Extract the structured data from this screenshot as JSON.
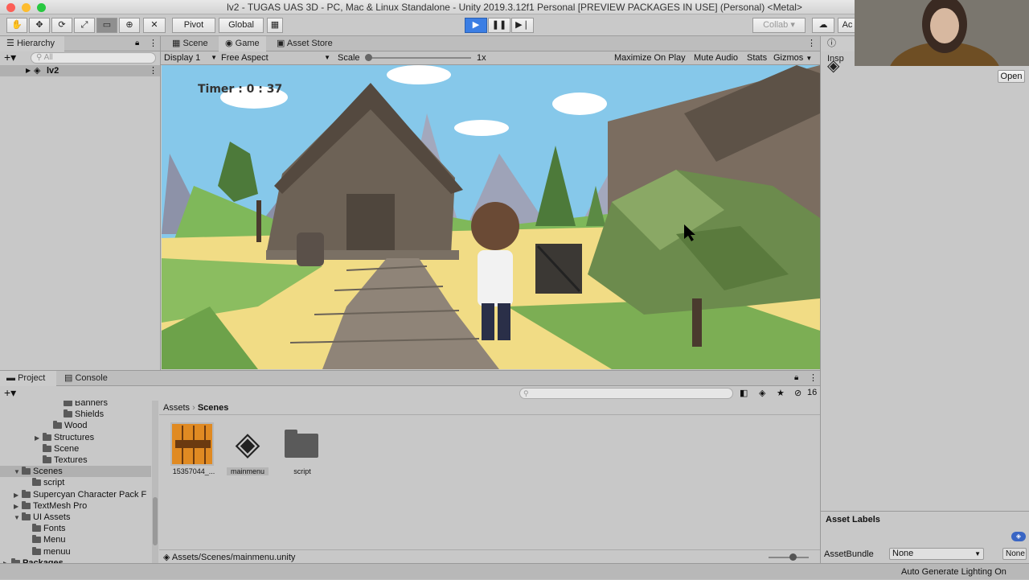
{
  "window": {
    "title": "lv2 - TUGAS UAS 3D - PC, Mac & Linux Standalone - Unity 2019.3.12f1 Personal [PREVIEW PACKAGES IN USE] (Personal) <Metal>"
  },
  "toolbar": {
    "pivot": "Pivot",
    "global": "Global",
    "collab": "Collab",
    "account": "Ac"
  },
  "hierarchy": {
    "tab": "Hierarchy",
    "search_placeholder": "All",
    "root_item": "lv2"
  },
  "game_tabs": {
    "scene": "Scene",
    "game": "Game",
    "asset_store": "Asset Store"
  },
  "game_toolbar": {
    "display": "Display 1",
    "aspect": "Free Aspect",
    "scale_label": "Scale",
    "scale_value": "1x",
    "maximize": "Maximize On Play",
    "mute": "Mute Audio",
    "stats": "Stats",
    "gizmos": "Gizmos"
  },
  "game": {
    "timer": "Timer : 0 : 37"
  },
  "inspector": {
    "tab": "Insp",
    "open_button": "Open",
    "asset_labels": "Asset Labels",
    "assetbundle_label": "AssetBundle",
    "assetbundle_value": "None",
    "variant_value": "None"
  },
  "project": {
    "tab_project": "Project",
    "tab_console": "Console",
    "hidden_count": "16",
    "tree": [
      {
        "label": "Banners",
        "indent": 5,
        "type": "folder"
      },
      {
        "label": "Shields",
        "indent": 5,
        "type": "folder"
      },
      {
        "label": "Wood",
        "indent": 4,
        "type": "folder"
      },
      {
        "label": "Structures",
        "indent": 3,
        "type": "folder",
        "arrow": "▶"
      },
      {
        "label": "Scene",
        "indent": 3,
        "type": "folder"
      },
      {
        "label": "Textures",
        "indent": 3,
        "type": "folder"
      },
      {
        "label": "Scenes",
        "indent": 1,
        "type": "folder",
        "arrow": "▼",
        "selected": true
      },
      {
        "label": "script",
        "indent": 2,
        "type": "folder"
      },
      {
        "label": "Supercyan Character Pack F",
        "indent": 1,
        "type": "folder",
        "arrow": "▶"
      },
      {
        "label": "TextMesh Pro",
        "indent": 1,
        "type": "folder",
        "arrow": "▶"
      },
      {
        "label": "UI Assets",
        "indent": 1,
        "type": "folder",
        "arrow": "▼"
      },
      {
        "label": "Fonts",
        "indent": 2,
        "type": "folder"
      },
      {
        "label": "Menu",
        "indent": 2,
        "type": "folder"
      },
      {
        "label": "menuu",
        "indent": 2,
        "type": "folder"
      },
      {
        "label": "Packages",
        "indent": 0,
        "type": "folder",
        "arrow": "▶",
        "bold": true
      }
    ],
    "breadcrumb": [
      "Assets",
      "Scenes"
    ],
    "assets": [
      {
        "label": "15357044_...",
        "kind": "image"
      },
      {
        "label": "mainmenu",
        "kind": "unity"
      },
      {
        "label": "script",
        "kind": "folder"
      }
    ],
    "footer_path": "Assets/Scenes/mainmenu.unity"
  },
  "status": {
    "text": "Auto Generate Lighting On"
  },
  "colors": {
    "play_active": "#3b7ee4",
    "selected_row": "#b0b0b0"
  },
  "icons": [
    "hand-icon",
    "move-icon",
    "rotate-icon",
    "scale-icon",
    "rect-icon",
    "transform-icon",
    "tools-icon",
    "play-icon",
    "pause-icon",
    "step-icon",
    "unity-logo-icon",
    "folder-icon",
    "lock-icon",
    "search-icon",
    "cloud-icon"
  ]
}
